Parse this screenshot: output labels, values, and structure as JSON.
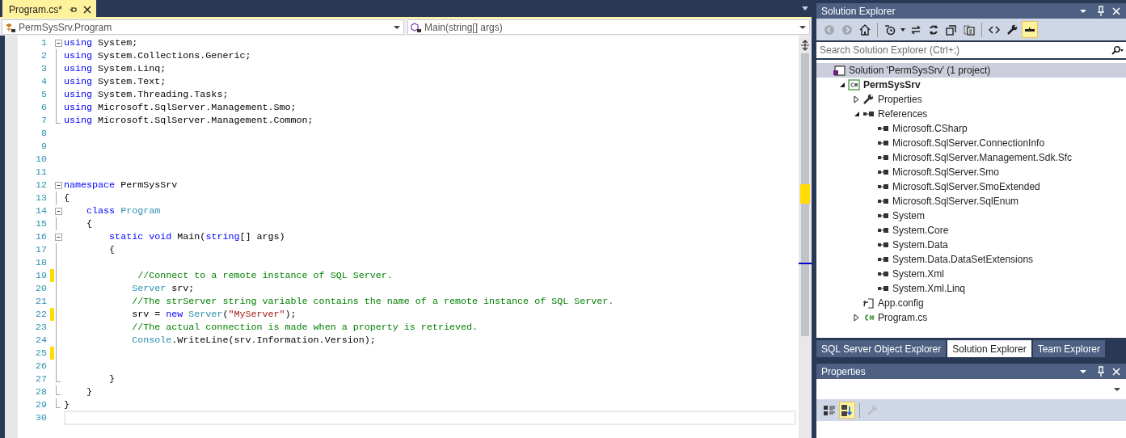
{
  "editor": {
    "tabs": [
      {
        "title": "Program.cs*",
        "selected": true
      }
    ],
    "type_dropdown": "PermSysSrv.Program",
    "member_dropdown": "Main(string[] args)",
    "lines": [
      {
        "number": "1",
        "kind": "fold-start",
        "changed": false,
        "current": false,
        "tokens": [
          {
            "kind": "kw",
            "text": "using"
          },
          {
            "kind": "text",
            "text": " System;"
          }
        ]
      },
      {
        "number": "2",
        "kind": "fold-inner",
        "changed": false,
        "current": false,
        "tokens": [
          {
            "kind": "kw",
            "text": "using"
          },
          {
            "kind": "text",
            "text": " System.Collections.Generic;"
          }
        ]
      },
      {
        "number": "3",
        "kind": "fold-inner",
        "changed": false,
        "current": false,
        "tokens": [
          {
            "kind": "kw",
            "text": "using"
          },
          {
            "kind": "text",
            "text": " System.Linq;"
          }
        ]
      },
      {
        "number": "4",
        "kind": "fold-inner",
        "changed": false,
        "current": false,
        "tokens": [
          {
            "kind": "kw",
            "text": "using"
          },
          {
            "kind": "text",
            "text": " System.Text;"
          }
        ]
      },
      {
        "number": "5",
        "kind": "fold-inner",
        "changed": false,
        "current": false,
        "tokens": [
          {
            "kind": "kw",
            "text": "using"
          },
          {
            "kind": "text",
            "text": " System.Threading.Tasks;"
          }
        ]
      },
      {
        "number": "6",
        "kind": "fold-inner",
        "changed": false,
        "current": false,
        "tokens": [
          {
            "kind": "kw",
            "text": "using"
          },
          {
            "kind": "text",
            "text": " Microsoft.SqlServer.Management.Smo;"
          }
        ]
      },
      {
        "number": "7",
        "kind": "fold-end",
        "changed": false,
        "current": false,
        "tokens": [
          {
            "kind": "kw",
            "text": "using"
          },
          {
            "kind": "text",
            "text": " Microsoft.SqlServer.Management.Common;"
          }
        ]
      },
      {
        "number": "8",
        "kind": "plain",
        "changed": false,
        "current": false
      },
      {
        "number": "9",
        "kind": "plain",
        "changed": false,
        "current": false
      },
      {
        "number": "10",
        "kind": "plain",
        "changed": false,
        "current": false
      },
      {
        "number": "11",
        "kind": "plain",
        "changed": false,
        "current": false
      },
      {
        "number": "12",
        "kind": "fold-start",
        "changed": false,
        "current": false,
        "tokens": [
          {
            "kind": "kw",
            "text": "namespace"
          },
          {
            "kind": "text",
            "text": " PermSysSrv"
          }
        ]
      },
      {
        "number": "13",
        "kind": "fold-inner",
        "changed": false,
        "current": false,
        "tokens": [
          {
            "kind": "text",
            "text": "{"
          }
        ]
      },
      {
        "number": "14",
        "kind": "fold-start",
        "changed": false,
        "current": false,
        "tokens": [
          {
            "kind": "kw",
            "text": "    class"
          },
          {
            "kind": "type",
            "text": " Program"
          }
        ]
      },
      {
        "number": "15",
        "kind": "fold-inner",
        "changed": false,
        "current": false,
        "tokens": [
          {
            "kind": "text",
            "text": "    {"
          }
        ]
      },
      {
        "number": "16",
        "kind": "fold-start",
        "changed": false,
        "current": false,
        "tokens": [
          {
            "kind": "kw",
            "text": "        static"
          },
          {
            "kind": "kw",
            "text": " void"
          },
          {
            "kind": "text",
            "text": " Main("
          },
          {
            "kind": "kw",
            "text": "string"
          },
          {
            "kind": "text",
            "text": "[] args)"
          }
        ]
      },
      {
        "number": "17",
        "kind": "fold-inner",
        "changed": false,
        "current": false,
        "tokens": [
          {
            "kind": "text",
            "text": "        {"
          }
        ]
      },
      {
        "number": "18",
        "kind": "fold-inner",
        "changed": false,
        "current": false
      },
      {
        "number": "19",
        "kind": "fold-inner",
        "changed": true,
        "current": false,
        "tokens": [
          {
            "kind": "comment",
            "text": "             //Connect to a remote instance of SQL Server."
          }
        ]
      },
      {
        "number": "20",
        "kind": "fold-inner",
        "changed": false,
        "current": false,
        "tokens": [
          {
            "kind": "type",
            "text": "            Server"
          },
          {
            "kind": "text",
            "text": " srv;"
          }
        ]
      },
      {
        "number": "21",
        "kind": "fold-inner",
        "changed": false,
        "current": false,
        "tokens": [
          {
            "kind": "comment",
            "text": "            //The strServer string variable contains the name of a remote instance of SQL Server."
          }
        ]
      },
      {
        "number": "22",
        "kind": "fold-inner",
        "changed": true,
        "current": false,
        "tokens": [
          {
            "kind": "text",
            "text": "            srv = "
          },
          {
            "kind": "kw",
            "text": "new"
          },
          {
            "kind": "type",
            "text": " Server"
          },
          {
            "kind": "text",
            "text": "("
          },
          {
            "kind": "string",
            "text": "\"MyServer\""
          },
          {
            "kind": "text",
            "text": ");"
          }
        ]
      },
      {
        "number": "23",
        "kind": "fold-inner",
        "changed": false,
        "current": false,
        "tokens": [
          {
            "kind": "comment",
            "text": "            //The actual connection is made when a property is retrieved."
          }
        ]
      },
      {
        "number": "24",
        "kind": "fold-inner",
        "changed": false,
        "current": false,
        "tokens": [
          {
            "kind": "type",
            "text": "            Console"
          },
          {
            "kind": "text",
            "text": ".WriteLine(srv.Information.Version);"
          }
        ]
      },
      {
        "number": "25",
        "kind": "fold-inner",
        "changed": true,
        "current": false
      },
      {
        "number": "26",
        "kind": "fold-inner",
        "changed": false,
        "current": false
      },
      {
        "number": "27",
        "kind": "fold-end",
        "changed": false,
        "current": false,
        "tokens": [
          {
            "kind": "text",
            "text": "        }"
          }
        ]
      },
      {
        "number": "28",
        "kind": "fold-end",
        "changed": false,
        "current": false,
        "tokens": [
          {
            "kind": "text",
            "text": "    }"
          }
        ]
      },
      {
        "number": "29",
        "kind": "fold-end",
        "changed": false,
        "current": false,
        "tokens": [
          {
            "kind": "text",
            "text": "}"
          }
        ]
      },
      {
        "number": "30",
        "kind": "plain",
        "changed": false,
        "current": true
      }
    ]
  },
  "solution_explorer": {
    "title": "Solution Explorer",
    "toolbar": [
      {
        "kind": "back",
        "disabled": true,
        "active": false
      },
      {
        "kind": "forward",
        "disabled": true,
        "active": false
      },
      {
        "kind": "home",
        "disabled": false,
        "active": false
      },
      {
        "kind": "separator"
      },
      {
        "kind": "pending-changes",
        "disabled": false,
        "active": false
      },
      {
        "kind": "sync",
        "disabled": false,
        "active": false
      },
      {
        "kind": "refresh",
        "disabled": false,
        "active": false
      },
      {
        "kind": "collapse-all",
        "disabled": false,
        "active": false
      },
      {
        "kind": "show-all-files",
        "disabled": false,
        "active": false
      },
      {
        "kind": "separator"
      },
      {
        "kind": "view-code",
        "disabled": false,
        "active": false
      },
      {
        "kind": "properties",
        "disabled": false,
        "active": false
      },
      {
        "kind": "preview",
        "disabled": false,
        "active": true
      }
    ],
    "search": {
      "placeholder": "Search Solution Explorer (Ctrl+;)"
    },
    "tree": [
      {
        "kind": "solution",
        "label": "Solution 'PermSysSrv' (1 project)",
        "selected": true,
        "children": [
          {
            "kind": "project",
            "label": "PermSysSrv",
            "selected": false,
            "expanded": true,
            "children": [
              {
                "kind": "properties",
                "label": "Properties",
                "selected": false,
                "expanded": false
              },
              {
                "kind": "references",
                "label": "References",
                "selected": false,
                "expanded": true,
                "children": [
                  {
                    "kind": "reference",
                    "label": "Microsoft.CSharp",
                    "selected": false
                  },
                  {
                    "kind": "reference",
                    "label": "Microsoft.SqlServer.ConnectionInfo",
                    "selected": false
                  },
                  {
                    "kind": "reference",
                    "label": "Microsoft.SqlServer.Management.Sdk.Sfc",
                    "selected": false
                  },
                  {
                    "kind": "reference",
                    "label": "Microsoft.SqlServer.Smo",
                    "selected": false
                  },
                  {
                    "kind": "reference",
                    "label": "Microsoft.SqlServer.SmoExtended",
                    "selected": false
                  },
                  {
                    "kind": "reference",
                    "label": "Microsoft.SqlServer.SqlEnum",
                    "selected": false
                  },
                  {
                    "kind": "reference",
                    "label": "System",
                    "selected": false
                  },
                  {
                    "kind": "reference",
                    "label": "System.Core",
                    "selected": false
                  },
                  {
                    "kind": "reference",
                    "label": "System.Data",
                    "selected": false
                  },
                  {
                    "kind": "reference",
                    "label": "System.Data.DataSetExtensions",
                    "selected": false
                  },
                  {
                    "kind": "reference",
                    "label": "System.Xml",
                    "selected": false
                  },
                  {
                    "kind": "reference",
                    "label": "System.Xml.Linq",
                    "selected": false
                  }
                ]
              },
              {
                "kind": "config",
                "label": "App.config",
                "selected": false
              },
              {
                "kind": "csharp",
                "label": "Program.cs",
                "selected": false,
                "expanded": false
              }
            ]
          }
        ]
      }
    ],
    "bottom_tabs": [
      {
        "label": "SQL Server Object Explorer",
        "selected": false
      },
      {
        "label": "Solution Explorer",
        "selected": true
      },
      {
        "label": "Team Explorer",
        "selected": false
      }
    ]
  },
  "properties": {
    "title": "Properties",
    "toolbar": [
      {
        "kind": "categorized",
        "disabled": false,
        "active": false
      },
      {
        "kind": "alphabetical",
        "disabled": false,
        "active": true
      },
      {
        "kind": "separator"
      },
      {
        "kind": "property-pages",
        "disabled": true,
        "active": false
      }
    ]
  }
}
